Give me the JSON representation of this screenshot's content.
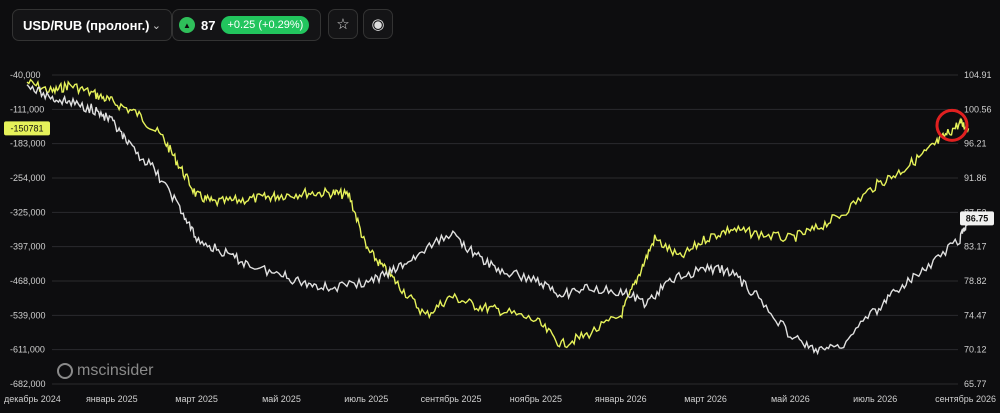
{
  "header": {
    "instrument": "USD/RUB (пролонг.)",
    "chevron_icon": "chevron-down-icon",
    "price": "87",
    "change": "+0.25 (+0.29%)",
    "star_icon": "star-icon",
    "eye_icon": "eye-icon",
    "colors": {
      "up_green": "#22c55e"
    }
  },
  "watermark": "mscinsider",
  "chart_data": {
    "type": "line",
    "x": [
      "декабрь 2024",
      "январь 2025",
      "март 2025",
      "май 2025",
      "июль 2025",
      "сентябрь 2025",
      "ноябрь 2025",
      "январь 2026",
      "март 2026",
      "май 2026",
      "июль 2026",
      "сентябрь 2026"
    ],
    "left_axis": {
      "ticks": [
        "-40,000",
        "-111,000",
        "-183,000",
        "-254,000",
        "-325,000",
        "-397,000",
        "-468,000",
        "-539,000",
        "-611,000",
        "-682,000"
      ],
      "ylim": [
        -682000,
        -40000
      ]
    },
    "right_axis": {
      "ticks": [
        "104.91",
        "100.56",
        "96.21",
        "91.86",
        "87.52",
        "83.17",
        "78.82",
        "74.47",
        "70.12",
        "65.77"
      ],
      "ylim": [
        65.77,
        104.91
      ]
    },
    "current_left_label": "-150781",
    "current_right_label": "86.75",
    "series": [
      {
        "color": "#e6f25a",
        "axis": "left",
        "x": [
          0,
          0.3,
          0.5,
          0.8,
          1,
          1.3,
          1.6,
          1.8,
          2,
          2.2,
          2.5,
          2.8,
          3,
          3.3,
          3.6,
          3.8,
          4,
          4.2,
          4.4,
          4.7,
          5,
          5.3,
          5.6,
          6,
          6.3,
          6.6,
          7,
          7.2,
          7.4,
          7.7,
          8,
          8.3,
          8.6,
          9,
          9.3,
          9.6,
          10,
          10.3,
          10.6,
          10.8,
          11,
          11.1
        ],
        "values": [
          -55000,
          -75000,
          -60000,
          -80000,
          -95000,
          -120000,
          -170000,
          -230000,
          -290000,
          -305000,
          -300000,
          -295000,
          -290000,
          -285000,
          -285000,
          -290000,
          -400000,
          -440000,
          -480000,
          -540000,
          -500000,
          -520000,
          -530000,
          -550000,
          -600000,
          -580000,
          -540000,
          -460000,
          -380000,
          -420000,
          -380000,
          -360000,
          -370000,
          -380000,
          -360000,
          -330000,
          -270000,
          -240000,
          -200000,
          -170000,
          -140000,
          -150781
        ]
      },
      {
        "color": "#e0e0e0",
        "axis": "right",
        "x": [
          0,
          0.3,
          0.5,
          0.8,
          1,
          1.2,
          1.5,
          1.8,
          2,
          2.3,
          2.6,
          3,
          3.3,
          3.6,
          4,
          4.3,
          4.6,
          5,
          5.3,
          5.6,
          6,
          6.3,
          6.6,
          7,
          7.3,
          7.6,
          8,
          8.3,
          8.6,
          9,
          9.3,
          9.6,
          10,
          10.3,
          10.6,
          11,
          11.1
        ],
        "values": [
          103.5,
          102,
          101.5,
          100.5,
          99,
          96,
          93,
          88,
          84,
          82.5,
          81,
          79.5,
          78.5,
          78,
          78.5,
          80,
          82,
          85,
          82,
          80,
          79,
          77,
          78,
          77.5,
          76,
          79,
          80.5,
          80,
          77,
          72,
          70,
          70.5,
          75,
          78,
          80.5,
          84,
          86.75
        ]
      }
    ]
  }
}
